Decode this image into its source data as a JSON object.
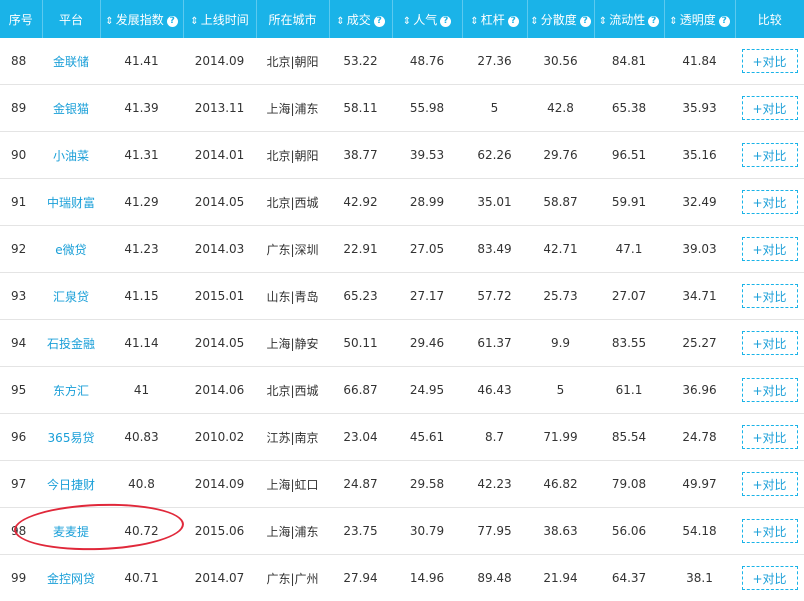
{
  "columns": [
    {
      "label": "序号",
      "sortable": false,
      "help": false
    },
    {
      "label": "平台",
      "sortable": false,
      "help": false
    },
    {
      "label": "发展指数",
      "sortable": true,
      "help": true
    },
    {
      "label": "上线时间",
      "sortable": true,
      "help": false
    },
    {
      "label": "所在城市",
      "sortable": false,
      "help": false
    },
    {
      "label": "成交",
      "sortable": true,
      "help": true
    },
    {
      "label": "人气",
      "sortable": true,
      "help": true
    },
    {
      "label": "杠杆",
      "sortable": true,
      "help": true
    },
    {
      "label": "分散度",
      "sortable": true,
      "help": true
    },
    {
      "label": "流动性",
      "sortable": true,
      "help": true
    },
    {
      "label": "透明度",
      "sortable": true,
      "help": true
    },
    {
      "label": "比较",
      "sortable": false,
      "help": false
    }
  ],
  "sort_glyph": "⇕",
  "help_glyph": "?",
  "compare_label": "+对比",
  "highlighted_row": "98",
  "colors": {
    "header_bg": "#1ab3e8",
    "link": "#1a9fd8",
    "annotation": "#e0283a"
  },
  "rows": [
    {
      "rank": "88",
      "platform": "金联储",
      "index": "41.41",
      "online": "2014.09",
      "city": "北京|朝阳",
      "volume": "53.22",
      "popularity": "48.76",
      "leverage": "27.36",
      "dispersion": "30.56",
      "liquidity": "84.81",
      "transparency": "41.84"
    },
    {
      "rank": "89",
      "platform": "金银猫",
      "index": "41.39",
      "online": "2013.11",
      "city": "上海|浦东",
      "volume": "58.11",
      "popularity": "55.98",
      "leverage": "5",
      "dispersion": "42.8",
      "liquidity": "65.38",
      "transparency": "35.93"
    },
    {
      "rank": "90",
      "platform": "小油菜",
      "index": "41.31",
      "online": "2014.01",
      "city": "北京|朝阳",
      "volume": "38.77",
      "popularity": "39.53",
      "leverage": "62.26",
      "dispersion": "29.76",
      "liquidity": "96.51",
      "transparency": "35.16"
    },
    {
      "rank": "91",
      "platform": "中瑞财富",
      "index": "41.29",
      "online": "2014.05",
      "city": "北京|西城",
      "volume": "42.92",
      "popularity": "28.99",
      "leverage": "35.01",
      "dispersion": "58.87",
      "liquidity": "59.91",
      "transparency": "32.49"
    },
    {
      "rank": "92",
      "platform": "e微贷",
      "index": "41.23",
      "online": "2014.03",
      "city": "广东|深圳",
      "volume": "22.91",
      "popularity": "27.05",
      "leverage": "83.49",
      "dispersion": "42.71",
      "liquidity": "47.1",
      "transparency": "39.03"
    },
    {
      "rank": "93",
      "platform": "汇泉贷",
      "index": "41.15",
      "online": "2015.01",
      "city": "山东|青岛",
      "volume": "65.23",
      "popularity": "27.17",
      "leverage": "57.72",
      "dispersion": "25.73",
      "liquidity": "27.07",
      "transparency": "34.71"
    },
    {
      "rank": "94",
      "platform": "石投金融",
      "index": "41.14",
      "online": "2014.05",
      "city": "上海|静安",
      "volume": "50.11",
      "popularity": "29.46",
      "leverage": "61.37",
      "dispersion": "9.9",
      "liquidity": "83.55",
      "transparency": "25.27"
    },
    {
      "rank": "95",
      "platform": "东方汇",
      "index": "41",
      "online": "2014.06",
      "city": "北京|西城",
      "volume": "66.87",
      "popularity": "24.95",
      "leverage": "46.43",
      "dispersion": "5",
      "liquidity": "61.1",
      "transparency": "36.96"
    },
    {
      "rank": "96",
      "platform": "365易贷",
      "index": "40.83",
      "online": "2010.02",
      "city": "江苏|南京",
      "volume": "23.04",
      "popularity": "45.61",
      "leverage": "8.7",
      "dispersion": "71.99",
      "liquidity": "85.54",
      "transparency": "24.78"
    },
    {
      "rank": "97",
      "platform": "今日捷财",
      "index": "40.8",
      "online": "2014.09",
      "city": "上海|虹口",
      "volume": "24.87",
      "popularity": "29.58",
      "leverage": "42.23",
      "dispersion": "46.82",
      "liquidity": "79.08",
      "transparency": "49.97"
    },
    {
      "rank": "98",
      "platform": "麦麦提",
      "index": "40.72",
      "online": "2015.06",
      "city": "上海|浦东",
      "volume": "23.75",
      "popularity": "30.79",
      "leverage": "77.95",
      "dispersion": "38.63",
      "liquidity": "56.06",
      "transparency": "54.18"
    },
    {
      "rank": "99",
      "platform": "金控网贷",
      "index": "40.71",
      "online": "2014.07",
      "city": "广东|广州",
      "volume": "27.94",
      "popularity": "14.96",
      "leverage": "89.48",
      "dispersion": "21.94",
      "liquidity": "64.37",
      "transparency": "38.1"
    }
  ]
}
